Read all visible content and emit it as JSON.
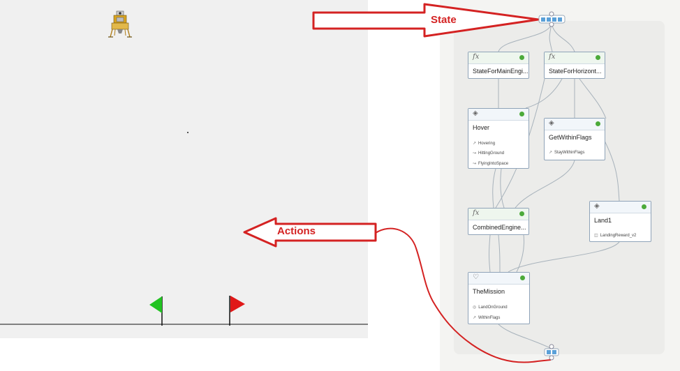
{
  "annotations": {
    "state_label": "State",
    "actions_label": "Actions"
  },
  "nodes": {
    "state_main": {
      "icon": "fx",
      "title": "StateForMainEngi..."
    },
    "state_horiz": {
      "icon": "fx",
      "title": "StateForHorizont..."
    },
    "hover": {
      "title": "Hover",
      "goals": [
        "Hovering",
        "HittingGround",
        "FlyingIntoSpace"
      ]
    },
    "get_within": {
      "title": "GetWithinFlags",
      "goals": [
        "StayWithinFlags"
      ]
    },
    "combined": {
      "icon": "fx",
      "title": "CombinedEngine..."
    },
    "land1": {
      "title": "Land1",
      "goals": [
        "LandingReward_v2"
      ]
    },
    "mission": {
      "title": "TheMission",
      "goals": [
        "LandOnGround",
        "WithinFlags"
      ]
    }
  },
  "colors": {
    "arrow_red": "#d42222",
    "flag_left": "#22c322",
    "flag_right": "#e01818",
    "status_dot": "#4caa3a"
  }
}
